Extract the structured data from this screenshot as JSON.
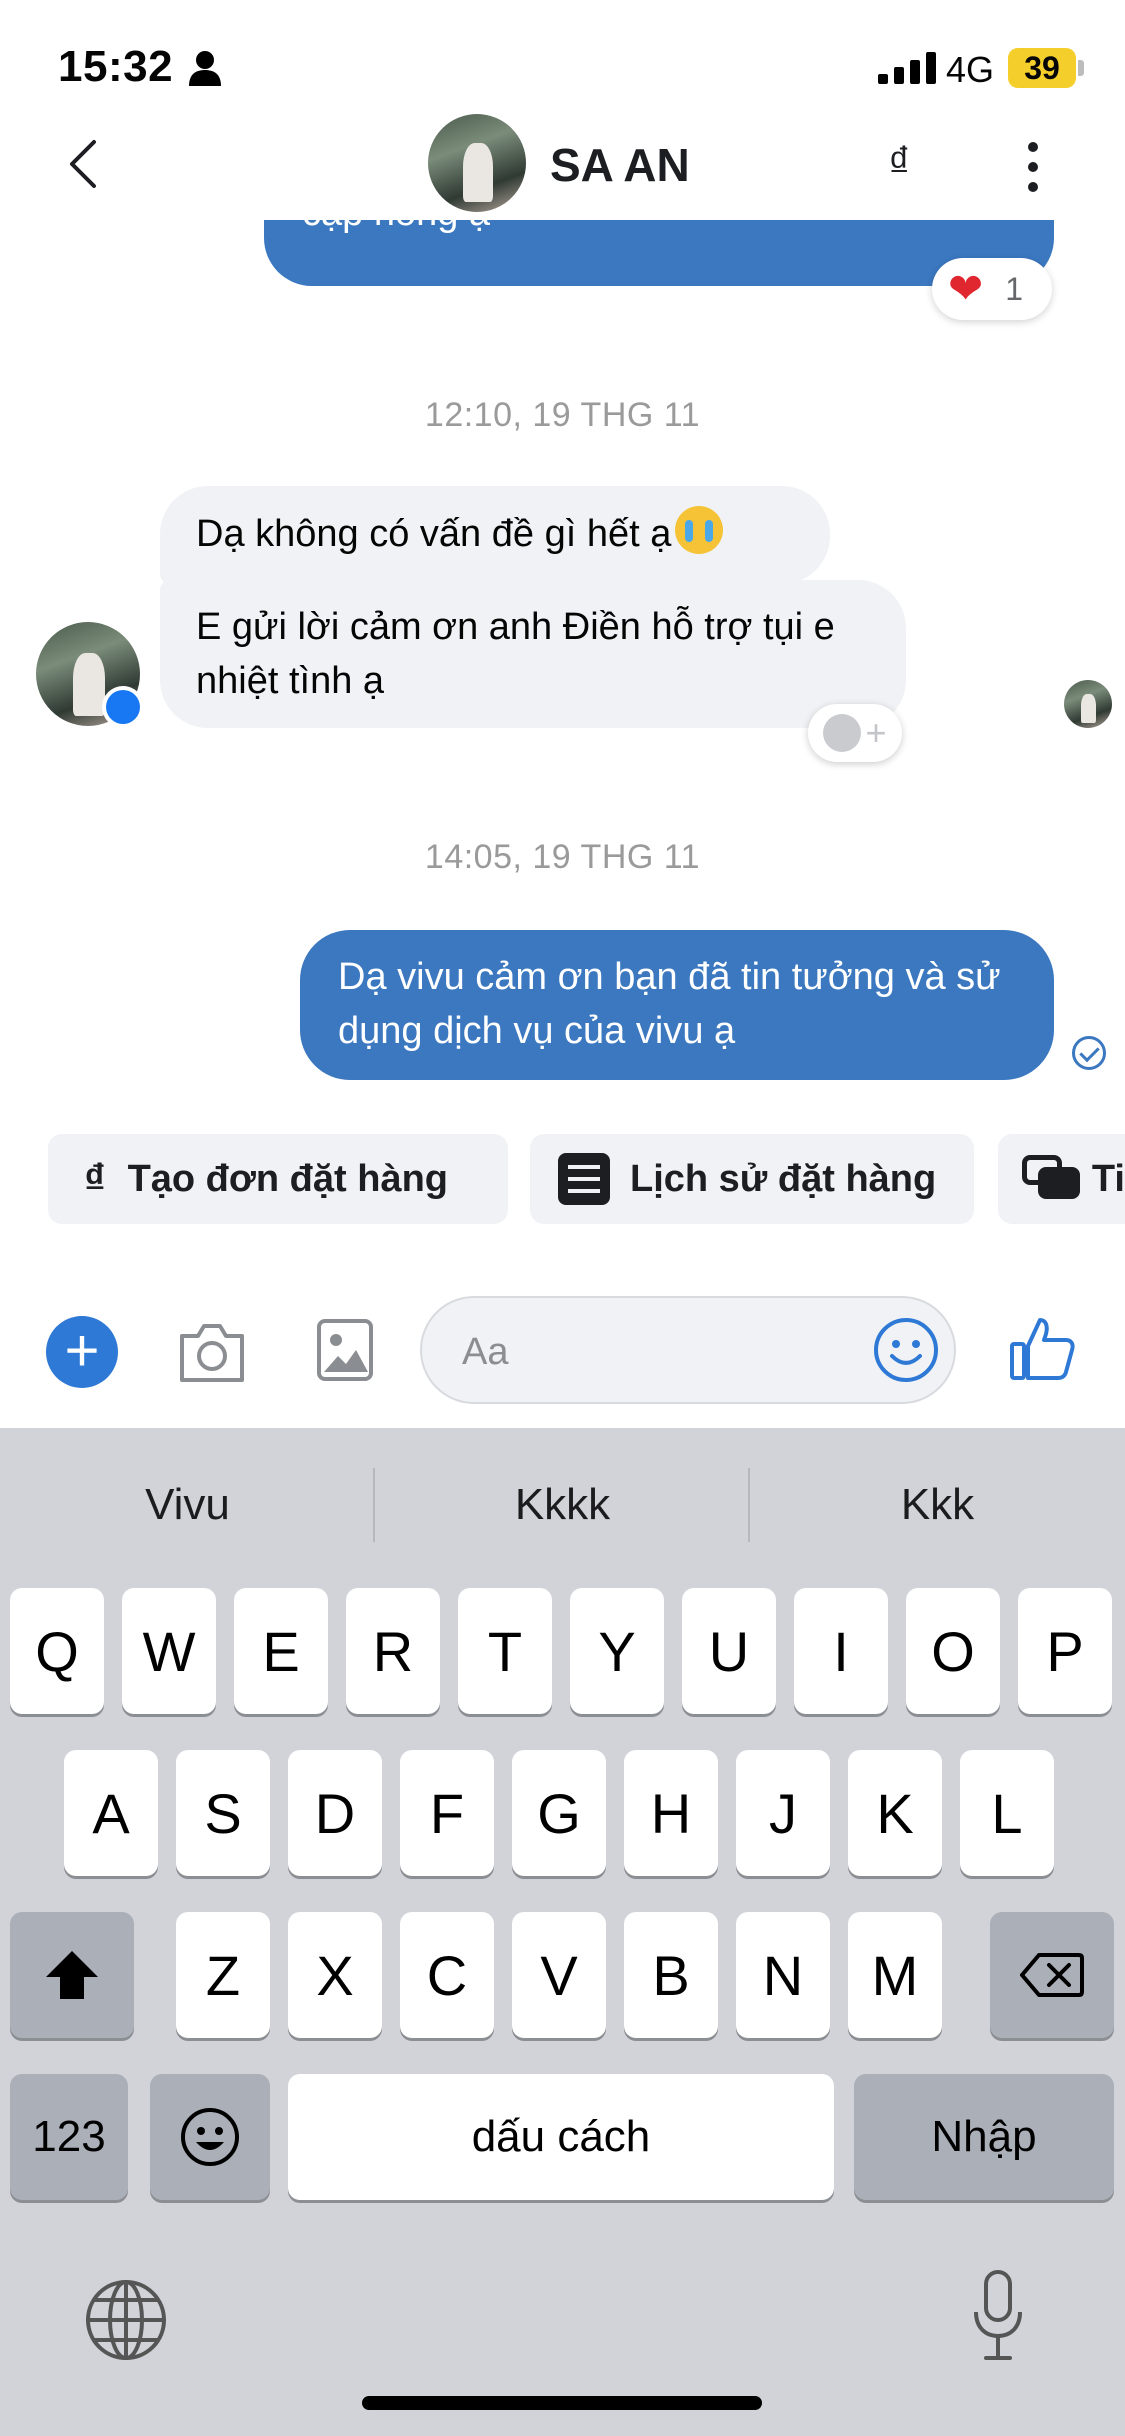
{
  "status_bar": {
    "time": "15:32",
    "network": "4G",
    "battery": "39"
  },
  "header": {
    "contact_name": "SA AN",
    "currency_symbol": "₫"
  },
  "messages": {
    "top_outgoing_partial": "cạp hong ạ",
    "reaction_count": "1",
    "timestamp_1": "12:10, 19 THG 11",
    "incoming_1": "Dạ không có vấn đề gì hết ạ",
    "incoming_2": "E gửi lời cảm ơn anh Điền hỗ trợ tụi e nhiệt tình ạ",
    "timestamp_2": "14:05, 19 THG 11",
    "outgoing_1": "Dạ vivu cảm ơn bạn đã tin tưởng và sử dụng dịch vụ của vivu ạ"
  },
  "quick_actions": {
    "create_order": "Tạo đơn đặt hàng",
    "order_history": "Lịch sử đặt hàng",
    "partial": "Ti",
    "create_order_icon": "₫"
  },
  "composer": {
    "placeholder": "Aa"
  },
  "keyboard": {
    "suggestions": [
      "Vivu",
      "Kkkk",
      "Kkk"
    ],
    "row1": [
      "Q",
      "W",
      "E",
      "R",
      "T",
      "Y",
      "U",
      "I",
      "O",
      "P"
    ],
    "row2": [
      "A",
      "S",
      "D",
      "F",
      "G",
      "H",
      "J",
      "K",
      "L"
    ],
    "row3": [
      "Z",
      "X",
      "C",
      "V",
      "B",
      "N",
      "M"
    ],
    "numbers_key": "123",
    "space_key": "dấu cách",
    "return_key": "Nhập"
  },
  "colors": {
    "accent_blue": "#3b78c0",
    "bubble_gray": "#f0f2f5",
    "keyboard_bg": "#d1d3d9"
  }
}
